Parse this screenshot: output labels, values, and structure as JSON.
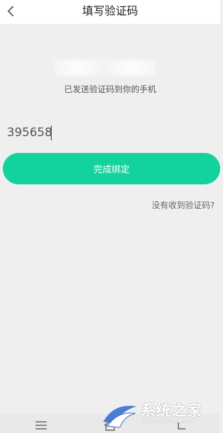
{
  "header": {
    "title": "填写验证码",
    "back_icon": "chevron-left-icon"
  },
  "verify": {
    "hint": "已发送验证码到你的手机",
    "code_value": "395658",
    "confirm_label": "完成绑定",
    "no_code_label": "没有收到验证码?"
  },
  "navbar": {
    "icons": [
      "menu-icon",
      "home-icon",
      "back-icon"
    ]
  },
  "watermark": {
    "text": "系统之家",
    "subtext": "XITONGZHIJIA.NET"
  },
  "colors": {
    "accent": "#12d39e",
    "background": "#efefef",
    "header_bg": "#ffffff"
  }
}
